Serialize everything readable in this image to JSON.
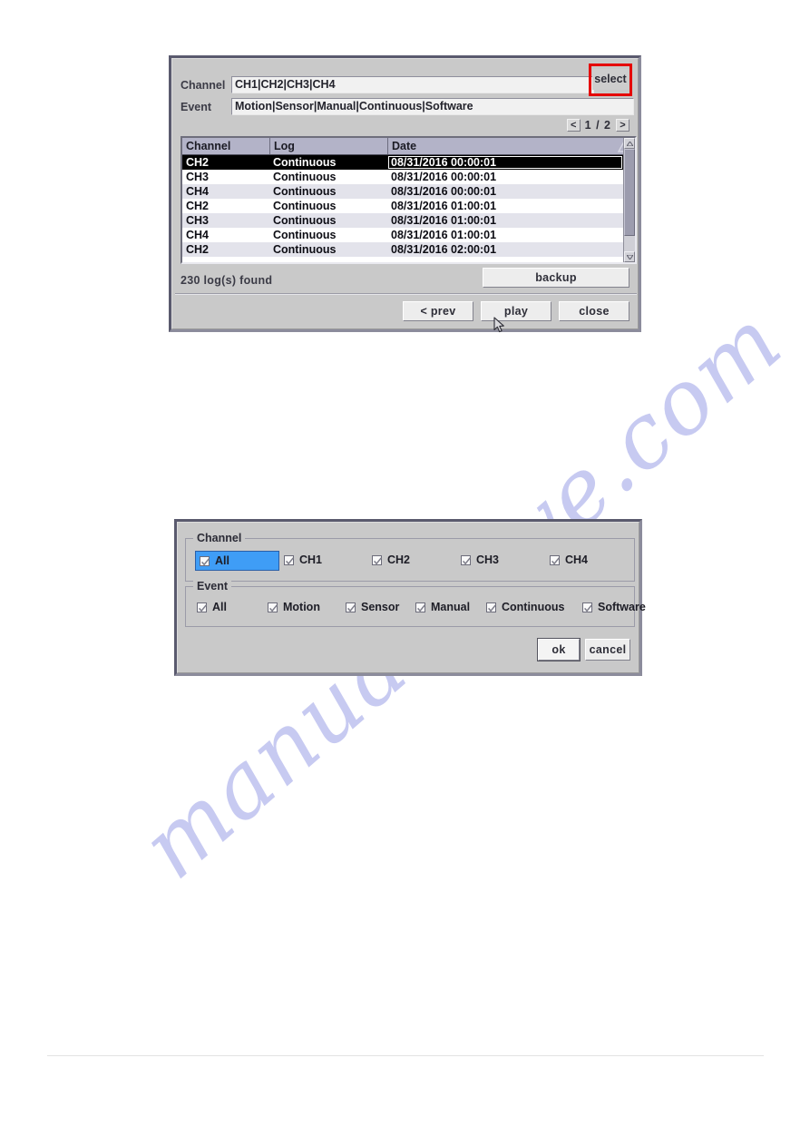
{
  "page": {
    "watermark_text": "manualshive.com"
  },
  "log_dialog": {
    "filters": [
      {
        "label": "Channel",
        "value": "CH1|CH2|CH3|CH4"
      },
      {
        "label": "Event",
        "value": "Motion|Sensor|Manual|Continuous|Software"
      }
    ],
    "select_button": "select",
    "pager": {
      "prev": "<",
      "next": ">",
      "text": "1 / 2",
      "current": "1",
      "total": "2"
    },
    "table": {
      "columns": [
        "Channel",
        "Log",
        "Date"
      ],
      "sort_indicator": "ascending-triangle",
      "rows": [
        {
          "channel": "CH2",
          "log": "Continuous",
          "date": "08/31/2016 00:00:01",
          "selected": true
        },
        {
          "channel": "CH3",
          "log": "Continuous",
          "date": "08/31/2016 00:00:01",
          "selected": false
        },
        {
          "channel": "CH4",
          "log": "Continuous",
          "date": "08/31/2016 00:00:01",
          "selected": false
        },
        {
          "channel": "CH2",
          "log": "Continuous",
          "date": "08/31/2016 01:00:01",
          "selected": false
        },
        {
          "channel": "CH3",
          "log": "Continuous",
          "date": "08/31/2016 01:00:01",
          "selected": false
        },
        {
          "channel": "CH4",
          "log": "Continuous",
          "date": "08/31/2016 01:00:01",
          "selected": false
        },
        {
          "channel": "CH2",
          "log": "Continuous",
          "date": "08/31/2016 02:00:01",
          "selected": false
        }
      ]
    },
    "status_text": "230  log(s)  found",
    "backup_button": "backup",
    "actions": [
      {
        "label": "< prev"
      },
      {
        "label": "play"
      },
      {
        "label": "close"
      }
    ]
  },
  "select_dialog": {
    "channel_group": {
      "title": "Channel",
      "items": [
        {
          "label": "All",
          "checked": true,
          "highlight": true
        },
        {
          "label": "CH1",
          "checked": true,
          "highlight": false
        },
        {
          "label": "CH2",
          "checked": true,
          "highlight": false
        },
        {
          "label": "CH3",
          "checked": true,
          "highlight": false
        },
        {
          "label": "CH4",
          "checked": true,
          "highlight": false
        }
      ]
    },
    "event_group": {
      "title": "Event",
      "items": [
        {
          "label": "All",
          "checked": true,
          "highlight": false
        },
        {
          "label": "Motion",
          "checked": true,
          "highlight": false
        },
        {
          "label": "Sensor",
          "checked": true,
          "highlight": false
        },
        {
          "label": "Manual",
          "checked": true,
          "highlight": false
        },
        {
          "label": "Continuous",
          "checked": true,
          "highlight": false
        },
        {
          "label": "Software",
          "checked": true,
          "highlight": false
        }
      ]
    },
    "ok_button": "ok",
    "cancel_button": "cancel"
  },
  "colors": {
    "dialog_bg": "#c9c9c9",
    "annotation_red": "#e50000",
    "table_header": "#b3b3c8",
    "row_alt": "#e3e3eb",
    "selected_row": "#000000",
    "highlight_blue": "#3f9df6",
    "watermark": "#c3c6f0"
  }
}
